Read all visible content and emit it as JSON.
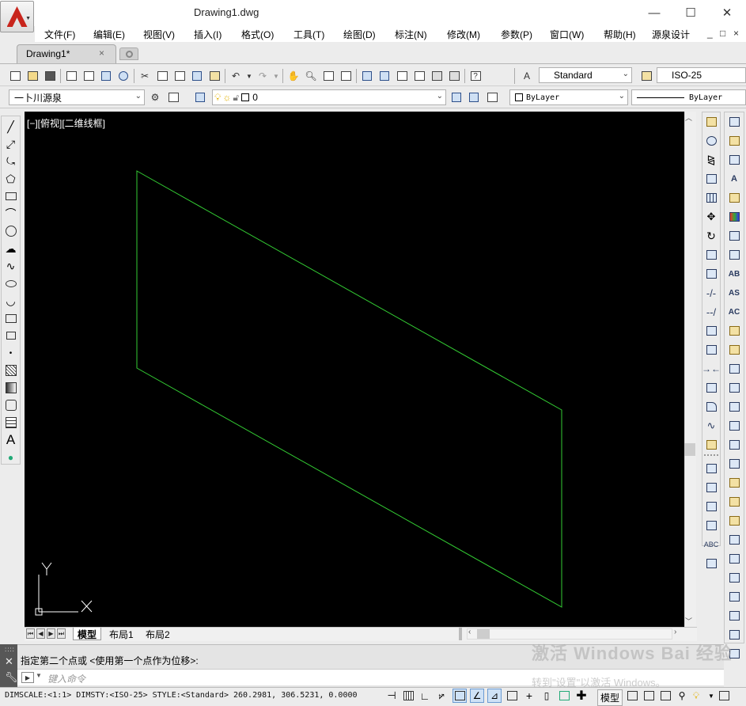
{
  "window": {
    "title": "Drawing1.dwg",
    "minimize": "—",
    "maximize": "☐",
    "close": "✕"
  },
  "menu": [
    "文件(F)",
    "编辑(E)",
    "视图(V)",
    "插入(I)",
    "格式(O)",
    "工具(T)",
    "绘图(D)",
    "标注(N)",
    "修改(M)",
    "参数(P)",
    "窗口(W)",
    "帮助(H)",
    "源泉设计"
  ],
  "mdi_controls": [
    "_",
    "□",
    "×"
  ],
  "doc_tab": {
    "label": "Drawing1*",
    "close": "×"
  },
  "toolbar1": {
    "text_style": "Standard",
    "dim_style": "ISO-25"
  },
  "toolbar2": {
    "workspace": "一卜川源泉",
    "layer": "0",
    "color": "ByLayer",
    "linetype": "ByLayer"
  },
  "viewport": {
    "label": "[−][俯视][二维线框]",
    "background": "#000000",
    "line_color": "#33cc33",
    "ucs_x": "X",
    "ucs_y": "Y"
  },
  "layout_tabs": [
    "模型",
    "布局1",
    "布局2"
  ],
  "command": {
    "history": "指定第二个点或 <使用第一个点作为位移>:",
    "placeholder": "键入命令",
    "prompt_icon": "▶"
  },
  "status": {
    "text": "DIMSCALE:<1:1> DIMSTY:<ISO-25> STYLE:<Standard>  260.2981, 306.5231, 0.0000",
    "model": "模型"
  },
  "watermark": {
    "line1": "激活 Windows  Bai 经验",
    "line2": "转到\"设置\"以激活 Windows。"
  },
  "accent": "#c8251c"
}
